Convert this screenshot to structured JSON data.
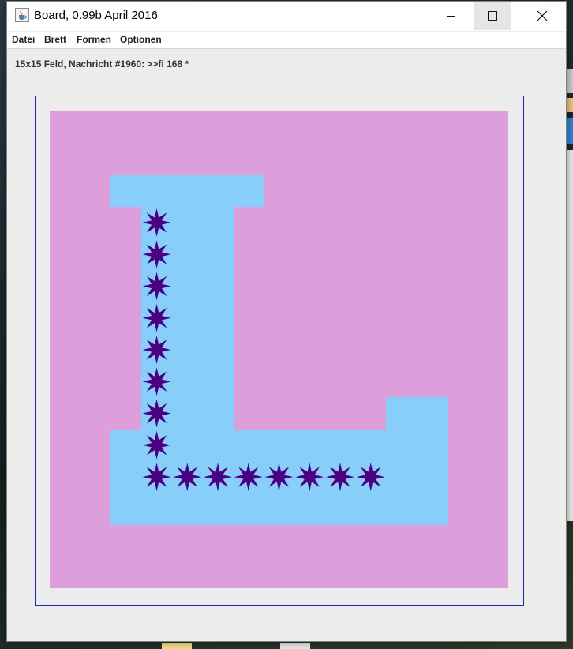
{
  "window": {
    "title": "Board, 0.99b April 2016",
    "icon": "java-cup-icon",
    "controls": [
      "minimize-icon",
      "maximize-icon",
      "close-icon"
    ]
  },
  "menu": {
    "items": [
      {
        "label": "Datei"
      },
      {
        "label": "Brett"
      },
      {
        "label": "Formen"
      },
      {
        "label": "Optionen"
      }
    ]
  },
  "status": {
    "text": "15x15 Feld, Nachricht #1960: >>fi 168 *"
  },
  "board": {
    "grid_size": 15,
    "colors": {
      "field": "#dc9fdc",
      "piece": "#87cefa",
      "star": "#4b0082",
      "frame": "#1a2aa8"
    },
    "shape_cells": [
      {
        "col": 2,
        "row": 2
      },
      {
        "col": 3,
        "row": 2
      },
      {
        "col": 4,
        "row": 2
      },
      {
        "col": 5,
        "row": 2
      },
      {
        "col": 6,
        "row": 2
      },
      {
        "col": 3,
        "row": 3
      },
      {
        "col": 4,
        "row": 3
      },
      {
        "col": 5,
        "row": 3
      },
      {
        "col": 3,
        "row": 4
      },
      {
        "col": 4,
        "row": 4
      },
      {
        "col": 5,
        "row": 4
      },
      {
        "col": 3,
        "row": 5
      },
      {
        "col": 4,
        "row": 5
      },
      {
        "col": 5,
        "row": 5
      },
      {
        "col": 3,
        "row": 6
      },
      {
        "col": 4,
        "row": 6
      },
      {
        "col": 5,
        "row": 6
      },
      {
        "col": 3,
        "row": 7
      },
      {
        "col": 4,
        "row": 7
      },
      {
        "col": 5,
        "row": 7
      },
      {
        "col": 3,
        "row": 8
      },
      {
        "col": 4,
        "row": 8
      },
      {
        "col": 5,
        "row": 8
      },
      {
        "col": 3,
        "row": 9
      },
      {
        "col": 4,
        "row": 9
      },
      {
        "col": 5,
        "row": 9
      },
      {
        "col": 11,
        "row": 9
      },
      {
        "col": 12,
        "row": 9
      },
      {
        "col": 2,
        "row": 10
      },
      {
        "col": 3,
        "row": 10
      },
      {
        "col": 4,
        "row": 10
      },
      {
        "col": 5,
        "row": 10
      },
      {
        "col": 6,
        "row": 10
      },
      {
        "col": 7,
        "row": 10
      },
      {
        "col": 8,
        "row": 10
      },
      {
        "col": 9,
        "row": 10
      },
      {
        "col": 10,
        "row": 10
      },
      {
        "col": 11,
        "row": 10
      },
      {
        "col": 12,
        "row": 10
      },
      {
        "col": 2,
        "row": 11
      },
      {
        "col": 3,
        "row": 11
      },
      {
        "col": 4,
        "row": 11
      },
      {
        "col": 5,
        "row": 11
      },
      {
        "col": 6,
        "row": 11
      },
      {
        "col": 7,
        "row": 11
      },
      {
        "col": 8,
        "row": 11
      },
      {
        "col": 9,
        "row": 11
      },
      {
        "col": 10,
        "row": 11
      },
      {
        "col": 11,
        "row": 11
      },
      {
        "col": 12,
        "row": 11
      },
      {
        "col": 2,
        "row": 12
      },
      {
        "col": 3,
        "row": 12
      },
      {
        "col": 4,
        "row": 12
      },
      {
        "col": 5,
        "row": 12
      },
      {
        "col": 6,
        "row": 12
      },
      {
        "col": 7,
        "row": 12
      },
      {
        "col": 8,
        "row": 12
      },
      {
        "col": 9,
        "row": 12
      },
      {
        "col": 10,
        "row": 12
      },
      {
        "col": 11,
        "row": 12
      },
      {
        "col": 12,
        "row": 12
      }
    ],
    "star_cells": [
      {
        "col": 3,
        "row": 3
      },
      {
        "col": 3,
        "row": 4
      },
      {
        "col": 3,
        "row": 5
      },
      {
        "col": 3,
        "row": 6
      },
      {
        "col": 3,
        "row": 7
      },
      {
        "col": 3,
        "row": 8
      },
      {
        "col": 3,
        "row": 9
      },
      {
        "col": 3,
        "row": 10
      },
      {
        "col": 3,
        "row": 11
      },
      {
        "col": 4,
        "row": 11
      },
      {
        "col": 5,
        "row": 11
      },
      {
        "col": 6,
        "row": 11
      },
      {
        "col": 7,
        "row": 11
      },
      {
        "col": 8,
        "row": 11
      },
      {
        "col": 9,
        "row": 11
      },
      {
        "col": 10,
        "row": 11
      }
    ]
  }
}
